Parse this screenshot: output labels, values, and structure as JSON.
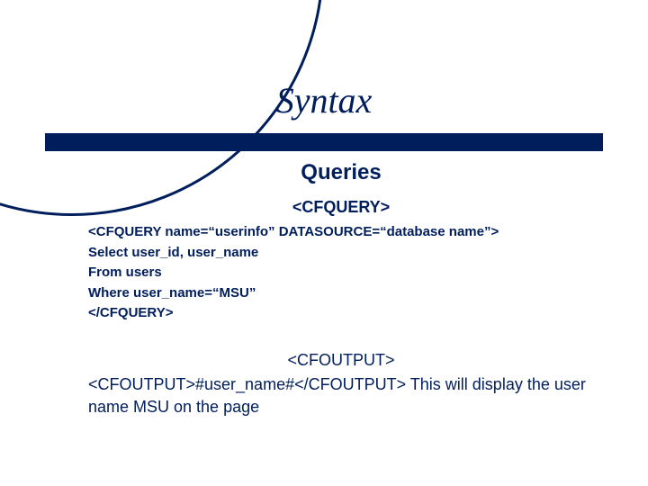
{
  "title": "Syntax",
  "subtitle": "Queries",
  "section1_heading": "<CFQUERY>",
  "code": {
    "l1": "<CFQUERY  name=“userinfo” DATASOURCE=“database name”>",
    "l2": "Select user_id, user_name",
    "l3": "From users",
    "l4": "Where user_name=“MSU”",
    "l5": "</CFQUERY>"
  },
  "section2_heading": "<CFOUTPUT>",
  "output": {
    "l1": "<CFOUTPUT>#user_name#</CFOUTPUT>",
    "l2": "This will display the user name MSU on the page"
  }
}
